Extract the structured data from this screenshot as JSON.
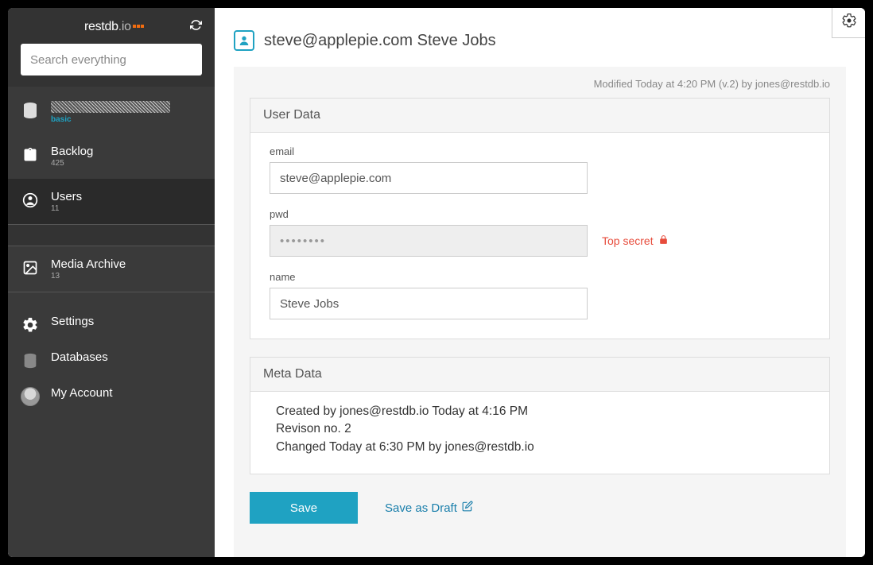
{
  "brand": {
    "name": "restdb",
    "suffix": ".io"
  },
  "search": {
    "placeholder": "Search everything"
  },
  "db": {
    "plan": "basic"
  },
  "sidebar": {
    "items": {
      "backlog": {
        "label": "Backlog",
        "count": "425"
      },
      "users": {
        "label": "Users",
        "count": "11"
      },
      "media": {
        "label": "Media Archive",
        "count": "13"
      }
    },
    "bottom": {
      "settings": "Settings",
      "databases": "Databases",
      "account": "My Account"
    }
  },
  "header": {
    "title": "steve@applepie.com Steve Jobs"
  },
  "record": {
    "modified": "Modified Today at 4:20 PM (v.2) by jones@restdb.io",
    "userdata_title": "User Data",
    "metadata_title": "Meta Data",
    "fields": {
      "email": {
        "label": "email",
        "value": "steve@applepie.com"
      },
      "pwd": {
        "label": "pwd",
        "value": "••••••••",
        "hint": "Top secret"
      },
      "name": {
        "label": "name",
        "value": "Steve Jobs"
      }
    },
    "meta": {
      "created": "Created by jones@restdb.io Today at 4:16 PM",
      "revision": "Revison no. 2",
      "changed": "Changed Today at 6:30 PM by jones@restdb.io"
    }
  },
  "buttons": {
    "save": "Save",
    "draft": "Save as Draft"
  }
}
